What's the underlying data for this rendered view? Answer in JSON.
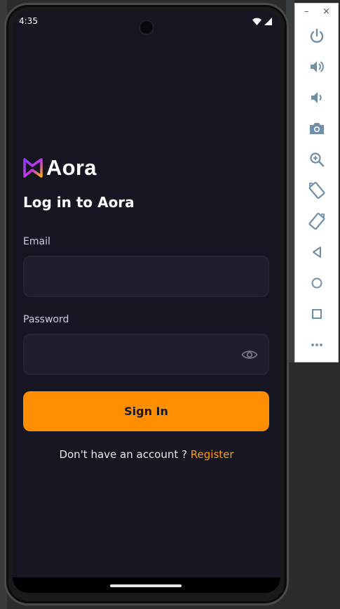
{
  "status_bar": {
    "time": "4:35"
  },
  "app": {
    "logo_text": "Aora",
    "heading": "Log in to Aora",
    "email": {
      "label": "Email",
      "value": "",
      "placeholder": ""
    },
    "password": {
      "label": "Password",
      "value": "",
      "placeholder": ""
    },
    "sign_in_label": "Sign In",
    "footer_prompt": "Don't have an account ?",
    "register_link": "Register"
  },
  "emulator_panel": {
    "window_controls": {
      "minimize": "–",
      "close": "×"
    },
    "tools": [
      "power-icon",
      "volume-up-icon",
      "volume-down-icon",
      "camera-icon",
      "zoom-icon",
      "rotate-left-icon",
      "rotate-right-icon",
      "back-icon",
      "home-icon",
      "overview-icon",
      "more-icon"
    ]
  },
  "colors": {
    "background": "#161622",
    "field": "#1e1e2d",
    "accent": "#ff8e01",
    "link": "#ff9c01"
  }
}
